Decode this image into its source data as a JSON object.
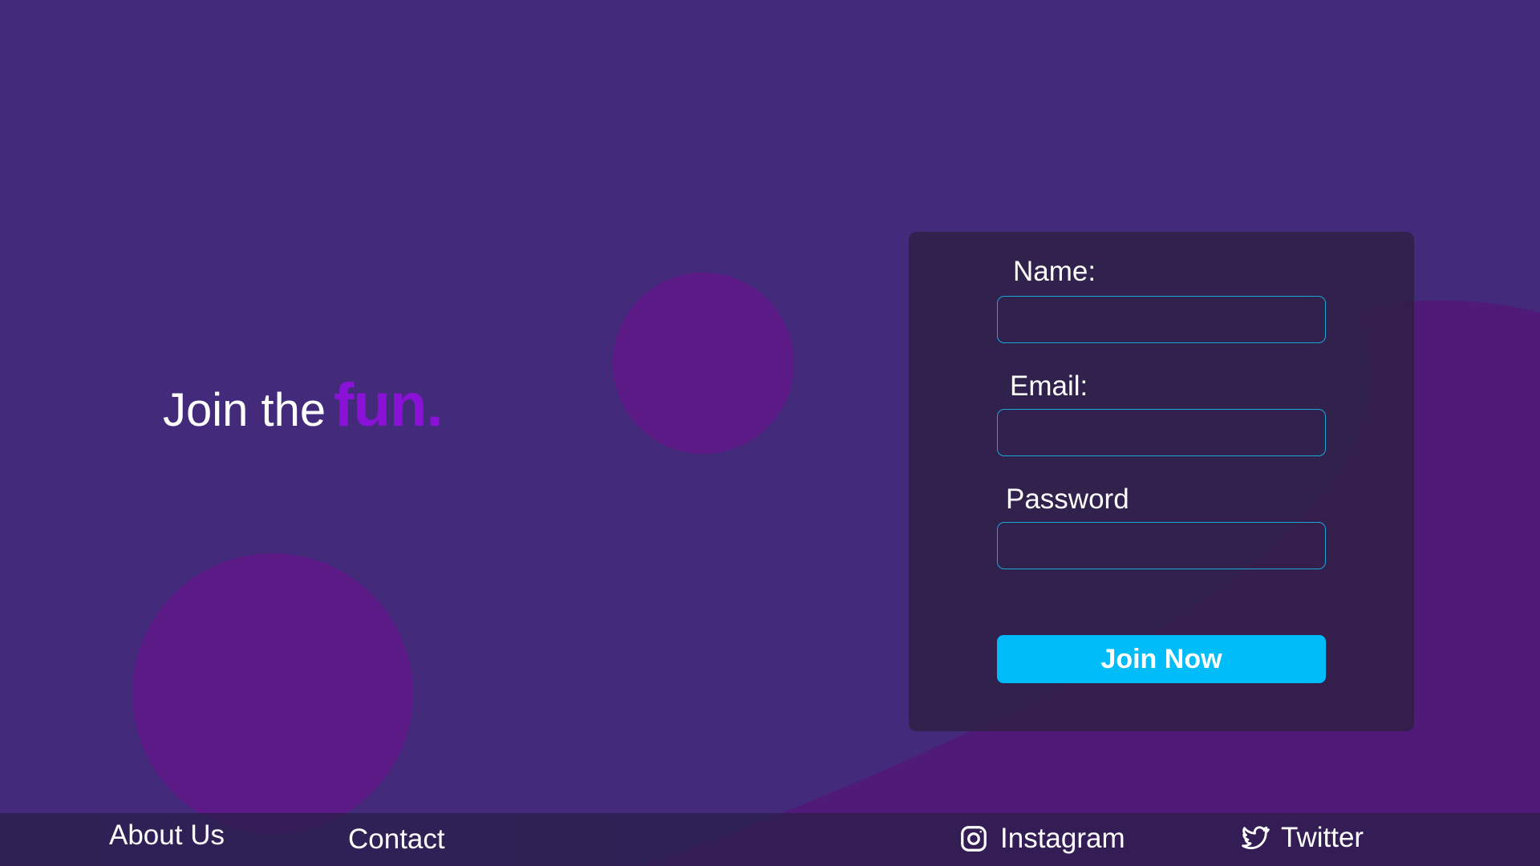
{
  "colors": {
    "background": "#432a7b",
    "curve": "#4f1a78",
    "circle": "#5c1a86",
    "accent": "#8a12d6",
    "button": "#00bdfa",
    "input_border": "#1aa6d9"
  },
  "hero": {
    "lead": "Join the",
    "accent": "fun."
  },
  "form": {
    "name_label": "Name:",
    "name_value": "",
    "email_label": "Email:",
    "email_value": "",
    "password_label": "Password",
    "password_value": "",
    "submit_label": "Join Now"
  },
  "footer": {
    "about_label": "About Us",
    "contact_label": "Contact",
    "instagram": {
      "label": "Instagram",
      "icon": "instagram-icon"
    },
    "twitter": {
      "label": "Twitter",
      "icon": "twitter-icon"
    }
  }
}
